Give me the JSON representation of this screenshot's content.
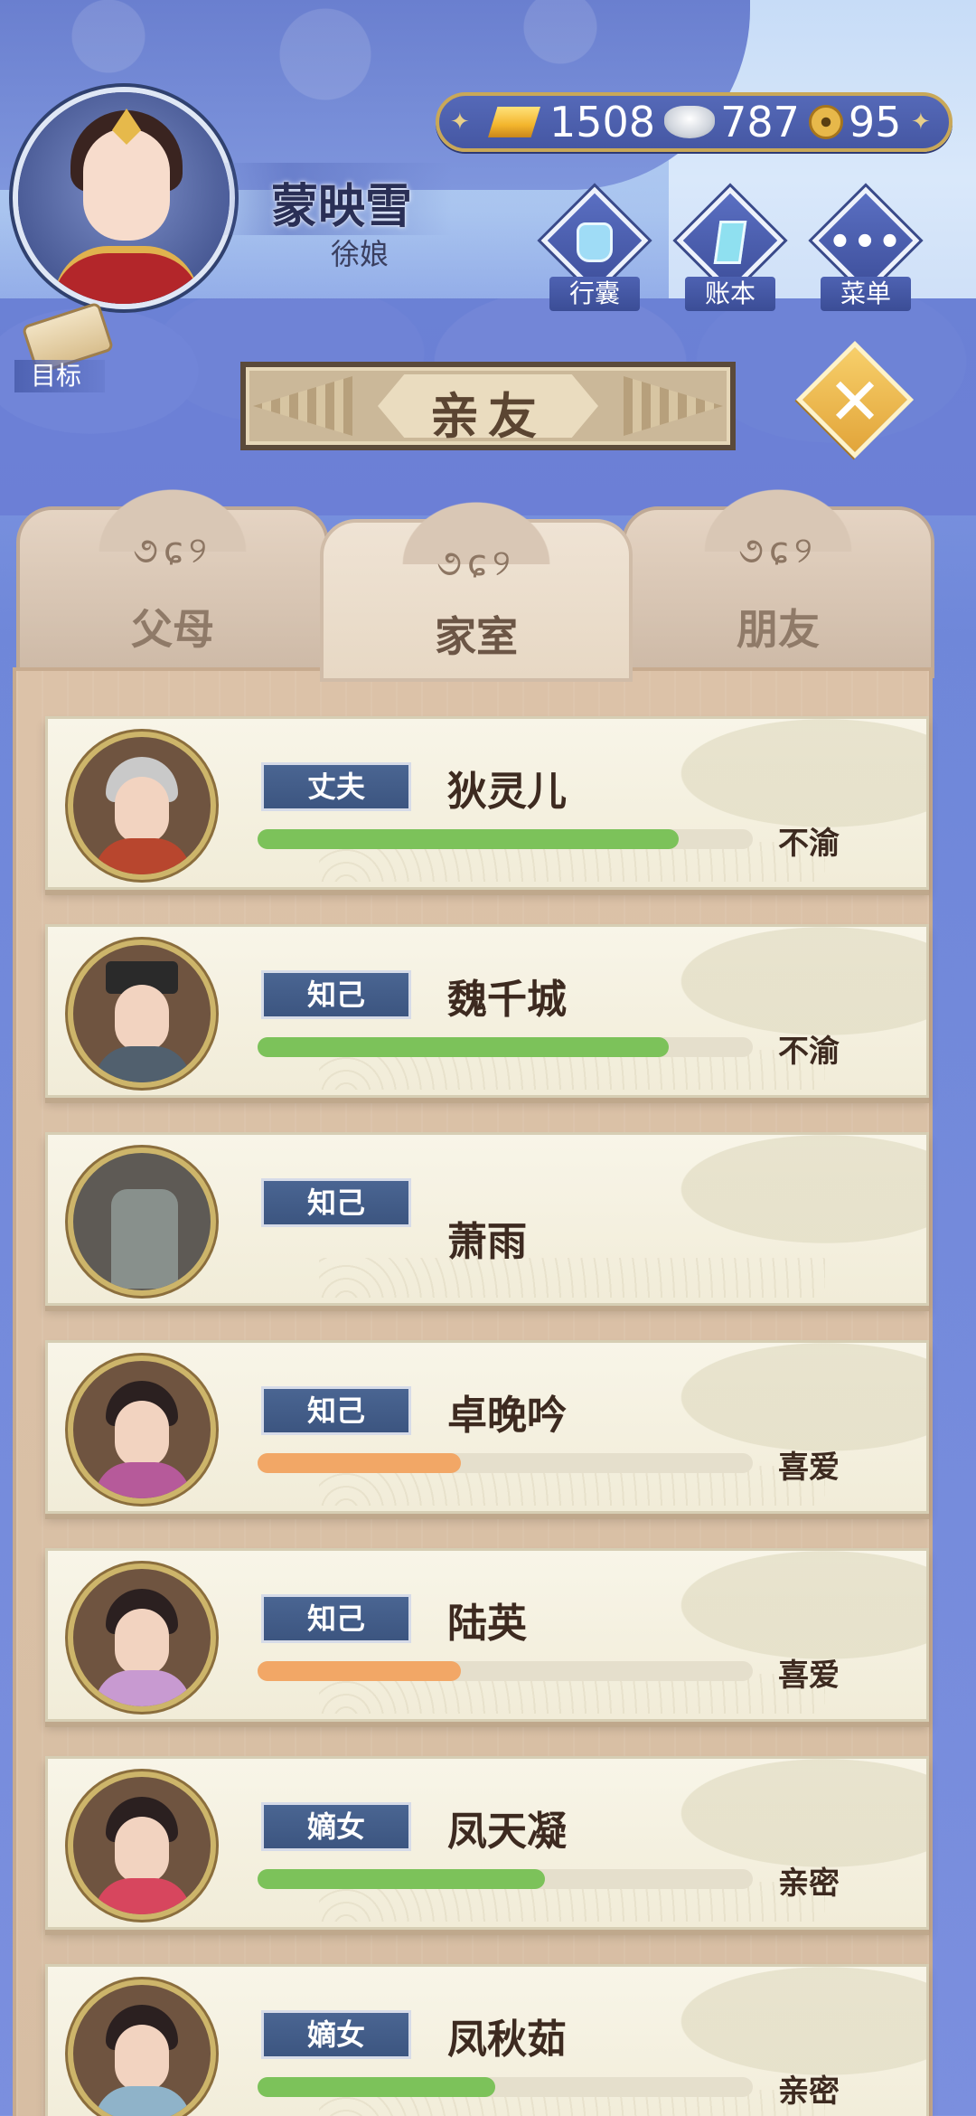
{
  "player": {
    "name": "蒙映雪",
    "title": "徐娘"
  },
  "currency": {
    "gold": "1508",
    "silver": "787",
    "coins": "95"
  },
  "menu": {
    "bag": "行囊",
    "ledger": "账本",
    "menu": "菜单",
    "goal": "目标"
  },
  "screen": {
    "title": "亲友"
  },
  "tabs": [
    {
      "label": "父母",
      "active": false
    },
    {
      "label": "家室",
      "active": true
    },
    {
      "label": "朋友",
      "active": false
    }
  ],
  "relations": [
    {
      "role": "丈夫",
      "name": "狄灵儿",
      "status": "不渝",
      "level": 0.85,
      "bar_color": "#7cc25a",
      "portrait_icon": "elder-portrait"
    },
    {
      "role": "知己",
      "name": "魏千城",
      "status": "不渝",
      "level": 0.83,
      "bar_color": "#7cc25a",
      "portrait_icon": "official-portrait"
    },
    {
      "role": "知己",
      "name": "萧雨",
      "status": "",
      "level": null,
      "bar_color": "#7cc25a",
      "portrait_icon": "tombstone-portrait"
    },
    {
      "role": "知己",
      "name": "卓晚吟",
      "status": "喜爱",
      "level": 0.41,
      "bar_color": "#f2a766",
      "portrait_icon": "lady-portrait"
    },
    {
      "role": "知己",
      "name": "陆英",
      "status": "喜爱",
      "level": 0.41,
      "bar_color": "#f2a766",
      "portrait_icon": "lady-portrait"
    },
    {
      "role": "嫡女",
      "name": "凤天凝",
      "status": "亲密",
      "level": 0.58,
      "bar_color": "#7cc25a",
      "portrait_icon": "lady-portrait"
    },
    {
      "role": "嫡女",
      "name": "凤秋茹",
      "status": "亲密",
      "level": 0.48,
      "bar_color": "#7cc25a",
      "portrait_icon": "lady-portrait"
    }
  ],
  "colors": {
    "accent_blue": "#4a6592",
    "panel_bg": "#dcc2a8",
    "card_bg": "#f8f5e8",
    "bar_green": "#7cc25a",
    "bar_orange": "#f2a766"
  }
}
